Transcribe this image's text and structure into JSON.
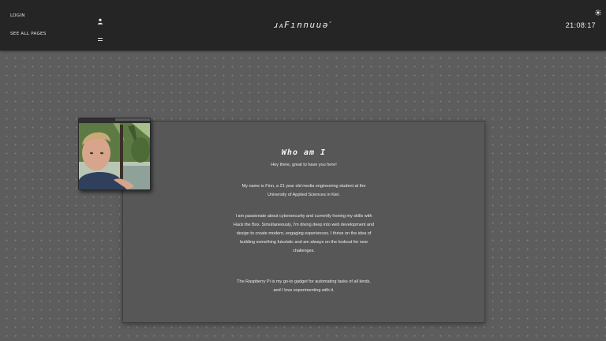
{
  "header": {
    "login_label": "LOGIN",
    "pages_label": "SEE ALL PAGES",
    "brand": "ɹᴀFınnuuəˊ",
    "clock": "21:08:17",
    "icons": {
      "login": "user-icon",
      "pages": "menu-icon",
      "theme": "sun-icon"
    }
  },
  "about": {
    "title": "Who am I",
    "greeting": "Hey there, great to have you here!",
    "intro": "My name is Finn, a 21 year old media engineering student at the University of Applied Sciences in Kiel.",
    "passion": "I am passionate about cybersecurity and currently honing my skills with Hack the Box. Simultaneously, I'm diving deep into web development and design to create modern, engaging experiences. I thrive on the idea of building something futuristic and am always on the lookout for new challenges.",
    "raspberry": "The Raspberry Pi is my go-to gadget for automating tasks of all kinds, and I love experimenting with it."
  },
  "colors": {
    "header_bg": "#252525",
    "page_bg": "#5d5d5d",
    "card_bg": "#575757",
    "text": "#ececec"
  }
}
